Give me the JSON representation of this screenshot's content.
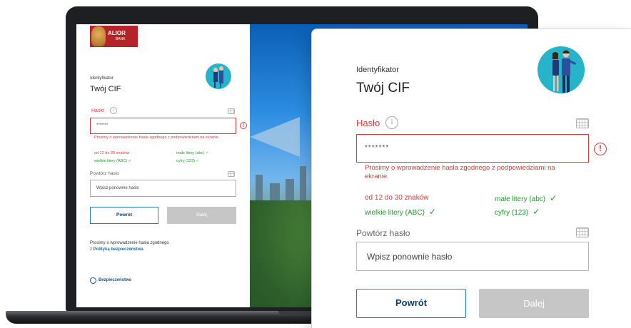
{
  "brand": {
    "name_line1": "ALIOR",
    "name_line2": "BANK"
  },
  "identifier": {
    "label": "Identyfikator",
    "value": "Twój CIF"
  },
  "password": {
    "label": "Hasło",
    "info_icon": "i",
    "masked_value": "*******",
    "error": "Prosimy o wprowadzenie hasła zgodnego z podpowiedziami na ekranie."
  },
  "rules": [
    {
      "text": "od 12 do 30 znaków",
      "status": "invalid"
    },
    {
      "text": "małe litery (abc)",
      "status": "valid"
    },
    {
      "text": "wielkie litery (ABC)",
      "status": "valid"
    },
    {
      "text": "cyfry (123)",
      "status": "valid"
    }
  ],
  "repeat": {
    "label": "Powtórz hasło",
    "placeholder": "Wpisz ponownie hasło"
  },
  "buttons": {
    "back": "Powrót",
    "next": "Dalej"
  },
  "footer": {
    "note": "Prosimy o wprowadzenie hasła zgodnego",
    "link_prefix": "z",
    "link_text": "Polityką bezpieczeństwa",
    "security_label": "Bezpieczeństwo"
  },
  "colors": {
    "error": "#e23a3a",
    "valid": "#1a9c2e",
    "accent": "#1a87b8",
    "disabled": "#c6c6c6"
  },
  "icons": {
    "info": "info-icon",
    "keyboard": "keyboard-icon",
    "error": "error-icon",
    "check": "check-icon",
    "shield": "shield-icon"
  }
}
